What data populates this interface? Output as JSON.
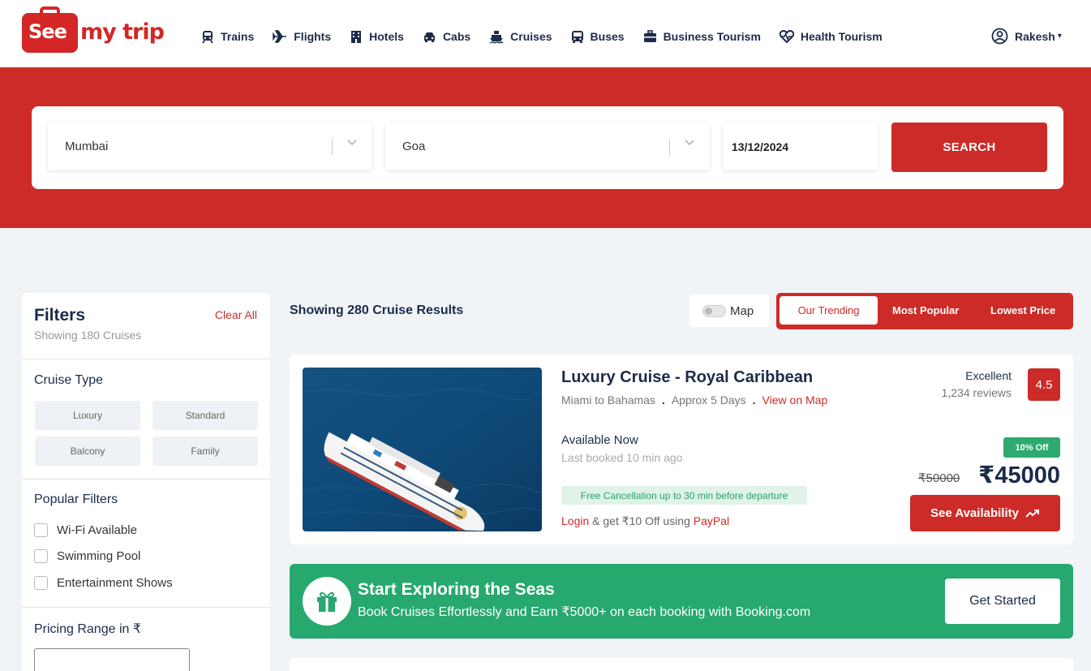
{
  "brand": {
    "logo_see": "See",
    "logo_rest": "my trip",
    "primary_color": "#cc2b27",
    "success_color": "#27a86e",
    "navy_color": "#1c2b4a"
  },
  "nav": {
    "items": [
      {
        "label": "Trains",
        "icon": "train-icon"
      },
      {
        "label": "Flights",
        "icon": "plane-icon"
      },
      {
        "label": "Hotels",
        "icon": "hotel-icon"
      },
      {
        "label": "Cabs",
        "icon": "car-icon"
      },
      {
        "label": "Cruises",
        "icon": "ship-icon"
      },
      {
        "label": "Buses",
        "icon": "bus-icon"
      },
      {
        "label": "Business Tourism",
        "icon": "briefcase-icon"
      },
      {
        "label": "Health Tourism",
        "icon": "heart-pulse-icon"
      }
    ],
    "user_name": "Rakesh"
  },
  "search": {
    "from": "Mumbai",
    "to": "Goa",
    "date": "13/12/2024",
    "button_label": "SEARCH"
  },
  "filters": {
    "title": "Filters",
    "subtitle": "Showing 180 Cruises",
    "clear_all": "Clear All",
    "cruise_type_heading": "Cruise Type",
    "cruise_types": [
      "Luxury",
      "Standard",
      "Balcony",
      "Family"
    ],
    "popular_heading": "Popular Filters",
    "popular": [
      "Wi-Fi Available",
      "Swimming Pool",
      "Entertainment Shows"
    ],
    "pricing_heading": "Pricing Range in ₹"
  },
  "results": {
    "count_text": "Showing 280 Cruise Results",
    "map_label": "Map",
    "sort_options": [
      "Our Trending",
      "Most Popular",
      "Lowest Price"
    ],
    "sort_active": "Our Trending"
  },
  "cruise": {
    "title": "Luxury Cruise - Royal Caribbean",
    "route": "Miami to Bahamas",
    "duration": "Approx 5 Days",
    "map_link": "View on Map",
    "availability": "Available Now",
    "last_booked": "Last booked 10 min ago",
    "free_cancellation": "Free Cancellation up to 30 min before departure",
    "login_text": "Login",
    "login_middle": " & get ₹10 Off using ",
    "paypal_text": "PayPal",
    "rating_word": "Excellent",
    "reviews": "1,234 reviews",
    "rating": "4.5",
    "discount": "10% Off",
    "old_price": "₹50000",
    "new_price": "₹45000",
    "cta": "See Availability"
  },
  "promo": {
    "title": "Start Exploring the Seas",
    "subtitle": "Book Cruises Effortlessly and Earn ₹5000+ on each booking with Booking.com",
    "button": "Get Started"
  }
}
